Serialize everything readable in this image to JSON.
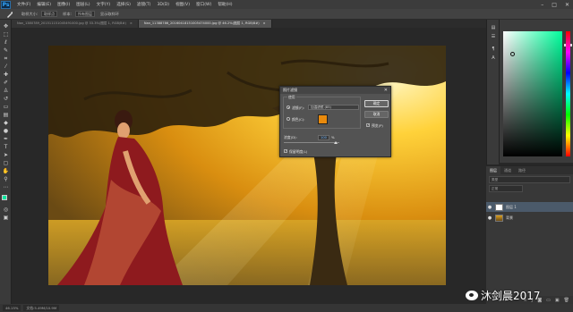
{
  "menubar": {
    "logo": "Ps",
    "items": [
      "文件(F)",
      "编辑(E)",
      "图像(I)",
      "图层(L)",
      "文字(Y)",
      "选择(S)",
      "滤镜(T)",
      "3D(D)",
      "视图(V)",
      "窗口(W)",
      "帮助(H)"
    ],
    "window_controls": [
      "–",
      "□",
      "✕"
    ]
  },
  "options": {
    "tool_icon": "eyedropper-icon",
    "sample_size_label": "取样大小:",
    "sample_size_value": "取样点",
    "sample_label": "样本:",
    "sample_value": "所有图层",
    "show_ring_label": "显示取样环"
  },
  "tabs": [
    {
      "label": "Nan_1380789_201511151045491000.jpg @ 33.3%(图层 1, RGB/8#)",
      "active": false
    },
    {
      "label": "Nan_11388786_20160418151005474000.jpg @ 46.2%(图层 1, RGB/8#)",
      "active": true
    }
  ],
  "dialog": {
    "title": "照片滤镜",
    "group_label": "使用",
    "filter_label": "滤镜(F):",
    "filter_value": "加温滤镜 (85)",
    "color_label": "颜色(C):",
    "color_hex": "#e98a0c",
    "density_label": "浓度(D):",
    "density_value": "100",
    "density_unit": "%",
    "preserve_label": "保留明度(L)",
    "ok_label": "确定",
    "cancel_label": "取消",
    "preview_label": "预览(P)",
    "filter_selected": true,
    "preview_checked": true,
    "preserve_checked": true
  },
  "layers": {
    "tabs": [
      "图层",
      "通道",
      "路径"
    ],
    "kind_filter": "类型",
    "blend_mode": "正常",
    "opacity_label": "不透明度:",
    "items": [
      {
        "name": "图层 1",
        "selected": true
      },
      {
        "name": "背景",
        "selected": false
      }
    ]
  },
  "status": {
    "zoom": "46.15%",
    "doc_info": "文档:5.49M/10.9M"
  },
  "watermark": {
    "text": "沐剑晨2017"
  }
}
